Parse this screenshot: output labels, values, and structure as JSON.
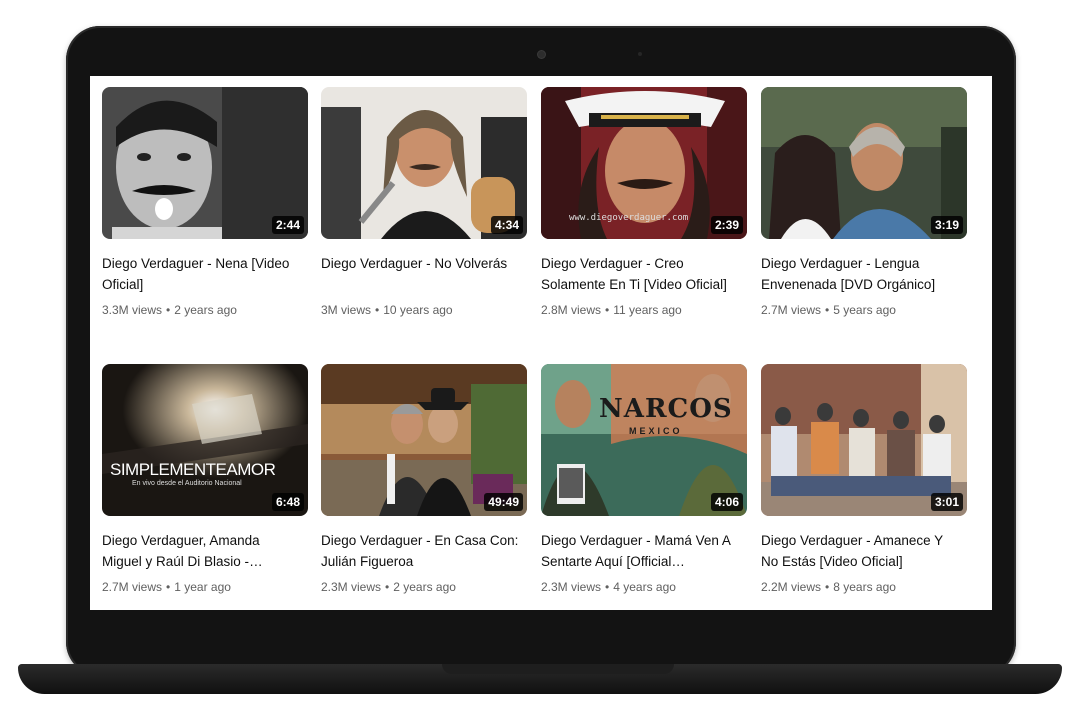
{
  "videos": [
    {
      "title": "Diego Verdaguer - Nena [Video Oficial]",
      "duration": "2:44",
      "views": "3.3M views",
      "age": "2 years ago",
      "thumb_overlay": ""
    },
    {
      "title": "Diego Verdaguer - No Volverás",
      "duration": "4:34",
      "views": "3M views",
      "age": "10 years ago",
      "thumb_overlay": ""
    },
    {
      "title": "Diego Verdaguer - Creo Solamente En Ti [Video Oficial]",
      "duration": "2:39",
      "views": "2.8M views",
      "age": "11 years ago",
      "thumb_overlay": "www.diegoverdaguer.com"
    },
    {
      "title": "Diego Verdaguer - Lengua Envenenada [DVD Orgánico]",
      "duration": "3:19",
      "views": "2.7M views",
      "age": "5 years ago",
      "thumb_overlay": ""
    },
    {
      "title": "Diego Verdaguer, Amanda Miguel y Raúl Di Blasio - Simplemente Amo...",
      "duration": "6:48",
      "views": "2.7M views",
      "age": "1 year ago",
      "thumb_overlay": "SIMPLEMENTEAMOR",
      "thumb_overlay_sub": "En vivo desde el Auditorio Nacional"
    },
    {
      "title": "Diego Verdaguer - En Casa Con: Julián Figueroa",
      "duration": "49:49",
      "views": "2.3M views",
      "age": "2 years ago",
      "thumb_overlay": ""
    },
    {
      "title": "Diego Verdaguer - Mamá Ven A Sentarte Aquí [Official Soundtrack]...",
      "duration": "4:06",
      "views": "2.3M views",
      "age": "4 years ago",
      "thumb_overlay": "NARCOS",
      "thumb_overlay_sub": "MEXICO"
    },
    {
      "title": "Diego Verdaguer - Amanece Y No Estás [Video Oficial]",
      "duration": "3:01",
      "views": "2.2M views",
      "age": "8 years ago",
      "thumb_overlay": ""
    }
  ]
}
